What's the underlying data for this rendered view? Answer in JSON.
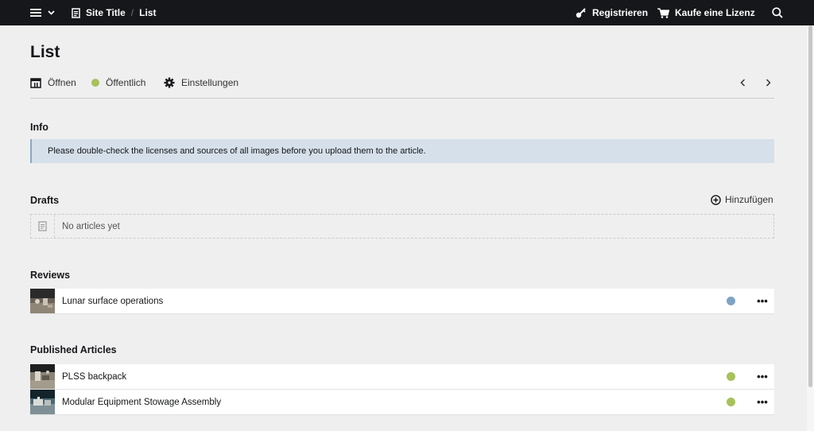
{
  "topbar": {
    "site_title": "Site Title",
    "separator": "/",
    "current": "List",
    "register_label": "Registrieren",
    "license_label": "Kaufe eine Lizenz",
    "icons": [
      "menu-icon",
      "chevron-down-icon",
      "document-icon",
      "key-icon",
      "cart-icon",
      "search-icon"
    ]
  },
  "page": {
    "title": "List",
    "actions": {
      "open_label": "Öffnen",
      "status_label": "Öffentlich",
      "status_color": "#a7c15b",
      "settings_label": "Einstellungen"
    }
  },
  "info": {
    "title": "Info",
    "message": "Please double-check the licenses and sources of all images before you upload them to the article."
  },
  "drafts": {
    "title": "Drafts",
    "add_label": "Hinzufügen",
    "empty_text": "No articles yet"
  },
  "reviews": {
    "title": "Reviews",
    "items": [
      {
        "label": "Lunar surface operations",
        "status_color": "#7ea3c4"
      }
    ]
  },
  "published": {
    "title": "Published Articles",
    "items": [
      {
        "label": "PLSS backpack",
        "status_color": "#a7c15b"
      },
      {
        "label": "Modular Equipment Stowage Assembly",
        "status_color": "#a7c15b"
      }
    ]
  }
}
